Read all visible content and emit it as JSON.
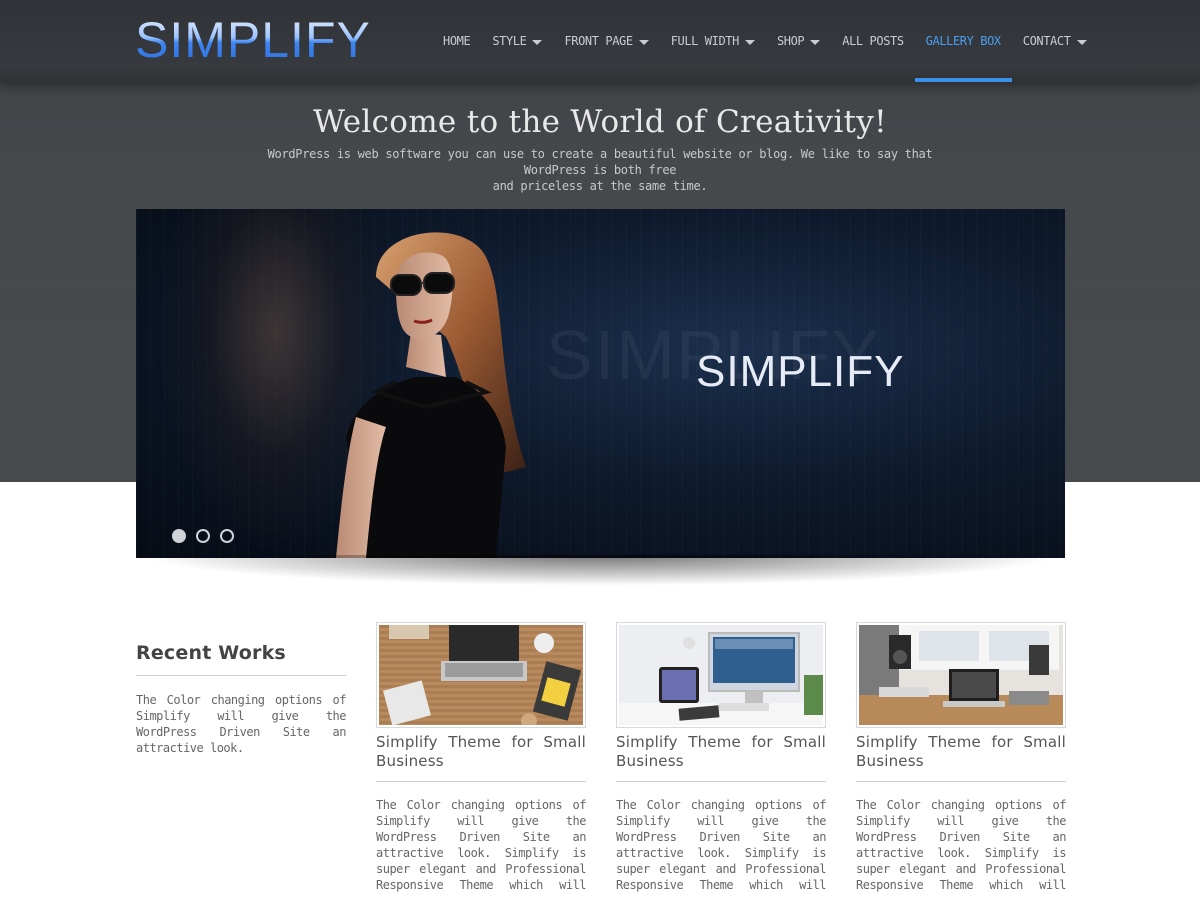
{
  "site": {
    "logo": "SIMPLIFY"
  },
  "nav": {
    "items": [
      {
        "label": "HOME",
        "dropdown": false
      },
      {
        "label": "STYLE",
        "dropdown": true
      },
      {
        "label": "FRONT PAGE",
        "dropdown": true
      },
      {
        "label": "FULL WIDTH",
        "dropdown": true
      },
      {
        "label": "SHOP",
        "dropdown": true
      },
      {
        "label": "ALL POSTS",
        "dropdown": false
      },
      {
        "label": "GALLERY BOX",
        "dropdown": false,
        "active": true
      },
      {
        "label": "CONTACT",
        "dropdown": true
      }
    ]
  },
  "hero": {
    "title": "Welcome to the World of Creativity!",
    "subtitle_line1": "WordPress is web software you can use to create a beautiful website or blog. We like to say that WordPress is both free",
    "subtitle_line2": "and priceless at the same time."
  },
  "slider": {
    "slide_logo": "SIMPLIFY",
    "ghost_text": "SIMPLIFY",
    "slide_count": 3,
    "active_slide": 1
  },
  "recent_works": {
    "title": "Recent Works",
    "description": "The Color changing options of Simplify will give the WordPress Driven Site an attractive look."
  },
  "cards": [
    {
      "title": "Simplify Theme for Small Business",
      "text": "The Color changing options of Simplify will give the WordPress Driven Site an attractive look. Simplify is super elegant and Professional Responsive Theme which will create the business widely expressed.",
      "image": "desk-laptop-notebook"
    },
    {
      "title": "Simplify Theme for Small Business",
      "text": "The Color changing options of Simplify will give the WordPress Driven Site an attractive look. Simplify is super elegant and Professional Responsive Theme which will create the business widely expressed.",
      "image": "imac-tablet-desk"
    },
    {
      "title": "Simplify Theme for Small Business",
      "text": "The Color changing options of Simplify will give the WordPress Driven Site an attractive look. Simplify is super elegant and Professional Responsive Theme which will create the business widely expressed.",
      "image": "studio-laptop-speakers"
    }
  ],
  "colors": {
    "accent": "#3b8fe6",
    "header_bg": "#33363a",
    "hero_bg": "#46494c"
  }
}
